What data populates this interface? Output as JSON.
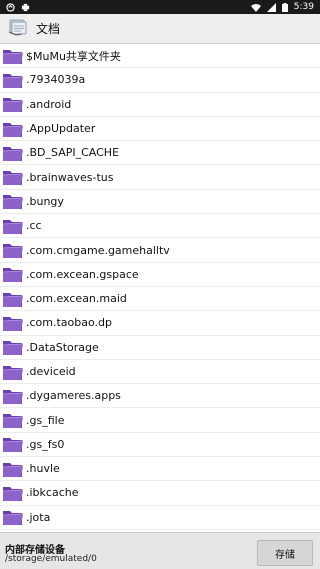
{
  "status_bar": {
    "time": "5:39",
    "left_icons": [
      "notification-icon",
      "print-icon"
    ],
    "right_icons": [
      "wifi-icon",
      "signal-icon",
      "battery-icon"
    ]
  },
  "app_bar": {
    "icon": "documents-icon",
    "title": "文档"
  },
  "files": [
    {
      "name": "$MuMu共享文件夹",
      "icon": "folder-icon"
    },
    {
      "name": ".7934039a",
      "icon": "folder-icon"
    },
    {
      "name": ".android",
      "icon": "folder-icon"
    },
    {
      "name": ".AppUpdater",
      "icon": "folder-icon"
    },
    {
      "name": ".BD_SAPI_CACHE",
      "icon": "folder-icon"
    },
    {
      "name": ".brainwaves-tus",
      "icon": "folder-icon"
    },
    {
      "name": ".bungy",
      "icon": "folder-icon"
    },
    {
      "name": ".cc",
      "icon": "folder-icon"
    },
    {
      "name": ".com.cmgame.gamehalltv",
      "icon": "folder-icon"
    },
    {
      "name": ".com.excean.gspace",
      "icon": "folder-icon"
    },
    {
      "name": ".com.excean.maid",
      "icon": "folder-icon"
    },
    {
      "name": ".com.taobao.dp",
      "icon": "folder-icon"
    },
    {
      "name": ".DataStorage",
      "icon": "folder-icon"
    },
    {
      "name": ".deviceid",
      "icon": "folder-icon"
    },
    {
      "name": ".dygameres.apps",
      "icon": "folder-icon"
    },
    {
      "name": ".gs_file",
      "icon": "folder-icon"
    },
    {
      "name": ".gs_fs0",
      "icon": "folder-icon"
    },
    {
      "name": ".huvle",
      "icon": "folder-icon"
    },
    {
      "name": ".ibkcache",
      "icon": "folder-icon"
    },
    {
      "name": ".jota",
      "icon": "folder-icon"
    }
  ],
  "bottom_bar": {
    "storage_title": "内部存储设备",
    "storage_path": "/storage/emulated/0",
    "save_label": "存储"
  },
  "colors": {
    "folder": "#8e63c9",
    "folder_dark": "#6a3fae",
    "status_bar": "#1a1a1a",
    "app_bar": "#eeeeee",
    "bottom_bar": "#e6e6e6"
  }
}
